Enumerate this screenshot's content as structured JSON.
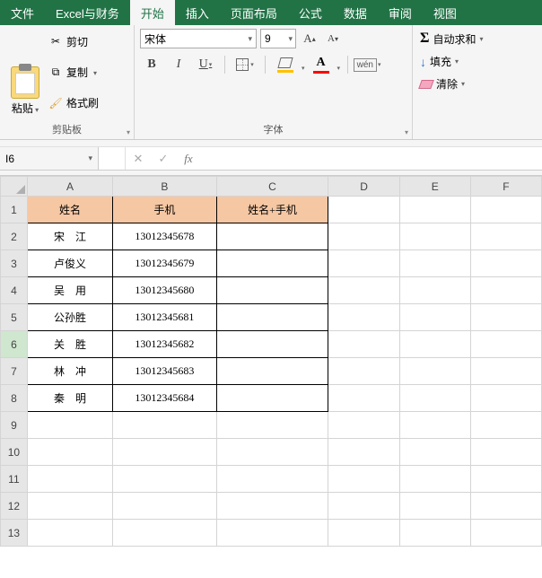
{
  "menu": {
    "file": "文件",
    "excel_finance": "Excel与财务",
    "home": "开始",
    "insert": "插入",
    "page_layout": "页面布局",
    "formulas": "公式",
    "data": "数据",
    "review": "审阅",
    "view": "视图"
  },
  "ribbon": {
    "clipboard": {
      "paste": "粘贴",
      "cut": "剪切",
      "copy": "复制",
      "format_painter": "格式刷",
      "group_label": "剪贴板"
    },
    "font": {
      "name": "宋体",
      "size": "9",
      "group_label": "字体",
      "phonetic": "wén"
    },
    "editing": {
      "autosum": "自动求和",
      "fill": "填充",
      "clear": "清除"
    }
  },
  "namebox": "I6",
  "formula_bar": "",
  "columns": [
    "A",
    "B",
    "C",
    "D",
    "E",
    "F"
  ],
  "rows": [
    "1",
    "2",
    "3",
    "4",
    "5",
    "6",
    "7",
    "8",
    "9",
    "10",
    "11",
    "12",
    "13"
  ],
  "headers": {
    "A": "姓名",
    "B": "手机",
    "C": "姓名+手机"
  },
  "data": [
    {
      "A": "宋　江",
      "B": "13012345678"
    },
    {
      "A": "卢俊义",
      "B": "13012345679"
    },
    {
      "A": "吴　用",
      "B": "13012345680"
    },
    {
      "A": "公孙胜",
      "B": "13012345681"
    },
    {
      "A": "关　胜",
      "B": "13012345682"
    },
    {
      "A": "林　冲",
      "B": "13012345683"
    },
    {
      "A": "秦　明",
      "B": "13012345684"
    }
  ]
}
